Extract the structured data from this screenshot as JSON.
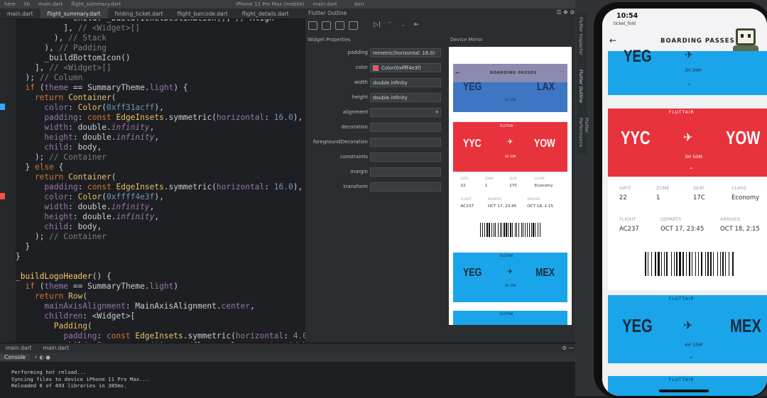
{
  "topbar": {
    "items": [
      "here",
      "lib",
      "main.dart",
      "flight_summary.dart",
      "iPhone 11 Pro Max (mobile)",
      "main.dart",
      "",
      "dart"
    ]
  },
  "tabs": [
    "main.dart",
    "flight_summary.dart",
    "folding_ticket.dart",
    "flight_barcode.dart",
    "flight_details.dart"
  ],
  "code_lines": [
    [
      [
        "pl",
        "            child: _buildTicketDestination(), // Align"
      ]
    ],
    [
      [
        "pl",
        "          ], "
      ],
      [
        "cm",
        "// <Widget>[]"
      ]
    ],
    [
      [
        "pl",
        "        ), "
      ],
      [
        "cm",
        "// Stack"
      ]
    ],
    [
      [
        "pl",
        "      ), "
      ],
      [
        "cm",
        "// Padding"
      ]
    ],
    [
      [
        "pl",
        "      _buildBottomIcon()"
      ]
    ],
    [
      [
        "pl",
        "    ], "
      ],
      [
        "cm",
        "// <Widget>[]"
      ]
    ],
    [
      [
        "pl",
        "  ); "
      ],
      [
        "cm",
        "// Column"
      ]
    ],
    [
      [
        "kw",
        "  if "
      ],
      [
        "pl",
        "("
      ],
      [
        "en",
        "theme"
      ],
      [
        "pl",
        " == SummaryTheme."
      ],
      [
        "en",
        "light"
      ],
      [
        "pl",
        ") {"
      ]
    ],
    [
      [
        "kw",
        "    return "
      ],
      [
        "cls",
        "Container"
      ],
      [
        "pl",
        "("
      ]
    ],
    [
      [
        "en",
        "      color"
      ],
      [
        "pl",
        ": "
      ],
      [
        "cls",
        "Color"
      ],
      [
        "pl",
        "("
      ],
      [
        "num",
        "0xff31acff"
      ],
      [
        "pl",
        "),"
      ]
    ],
    [
      [
        "en",
        "      padding"
      ],
      [
        "pl",
        ": "
      ],
      [
        "kw",
        "const "
      ],
      [
        "cls",
        "EdgeInsets"
      ],
      [
        "pl",
        ".symmetric("
      ],
      [
        "en",
        "horizontal"
      ],
      [
        "pl",
        ": "
      ],
      [
        "num",
        "16.0"
      ],
      [
        "pl",
        "),"
      ]
    ],
    [
      [
        "en",
        "      width"
      ],
      [
        "pl",
        ": double."
      ],
      [
        "it",
        "infinity"
      ],
      [
        "pl",
        ","
      ]
    ],
    [
      [
        "en",
        "      height"
      ],
      [
        "pl",
        ": double."
      ],
      [
        "it",
        "infinity"
      ],
      [
        "pl",
        ","
      ]
    ],
    [
      [
        "en",
        "      child"
      ],
      [
        "pl",
        ": body,"
      ]
    ],
    [
      [
        "pl",
        "    ); "
      ],
      [
        "cm",
        "// Container"
      ]
    ],
    [
      [
        "pl",
        "  } "
      ],
      [
        "kw",
        "else "
      ],
      [
        "pl",
        "{"
      ]
    ],
    [
      [
        "kw",
        "    return "
      ],
      [
        "cls",
        "Container"
      ],
      [
        "pl",
        "("
      ]
    ],
    [
      [
        "en",
        "      padding"
      ],
      [
        "pl",
        ": "
      ],
      [
        "kw",
        "const "
      ],
      [
        "cls",
        "EdgeInsets"
      ],
      [
        "pl",
        ".symmetric("
      ],
      [
        "en",
        "horizontal"
      ],
      [
        "pl",
        ": "
      ],
      [
        "num",
        "16.0"
      ],
      [
        "pl",
        "),"
      ]
    ],
    [
      [
        "en",
        "      color"
      ],
      [
        "pl",
        ": "
      ],
      [
        "cls",
        "Color"
      ],
      [
        "pl",
        "("
      ],
      [
        "num",
        "0xffff4e3f"
      ],
      [
        "pl",
        "),"
      ]
    ],
    [
      [
        "en",
        "      width"
      ],
      [
        "pl",
        ": double."
      ],
      [
        "it",
        "infinity"
      ],
      [
        "pl",
        ","
      ]
    ],
    [
      [
        "en",
        "      height"
      ],
      [
        "pl",
        ": double."
      ],
      [
        "it",
        "infinity"
      ],
      [
        "pl",
        ","
      ]
    ],
    [
      [
        "en",
        "      child"
      ],
      [
        "pl",
        ": body,"
      ]
    ],
    [
      [
        "pl",
        "    ); "
      ],
      [
        "cm",
        "// Container"
      ]
    ],
    [
      [
        "pl",
        "  }"
      ]
    ],
    [
      [
        "pl",
        "}"
      ]
    ],
    [
      [
        "pl",
        ""
      ]
    ],
    [
      [
        "fn",
        "_buildLogoHeader"
      ],
      [
        "pl",
        "() {"
      ]
    ],
    [
      [
        "kw",
        "  if "
      ],
      [
        "pl",
        "("
      ],
      [
        "en",
        "theme"
      ],
      [
        "pl",
        " == SummaryTheme."
      ],
      [
        "en",
        "light"
      ],
      [
        "pl",
        ")"
      ]
    ],
    [
      [
        "kw",
        "    return "
      ],
      [
        "cls",
        "Row"
      ],
      [
        "pl",
        "("
      ]
    ],
    [
      [
        "en",
        "      mainAxisAlignment"
      ],
      [
        "pl",
        ": MainAxisAlignment."
      ],
      [
        "en",
        "center"
      ],
      [
        "pl",
        ","
      ]
    ],
    [
      [
        "en",
        "      children"
      ],
      [
        "pl",
        ": <Widget>["
      ]
    ],
    [
      [
        "cls",
        "        Padding"
      ],
      [
        "pl",
        "("
      ]
    ],
    [
      [
        "en",
        "          padding"
      ],
      [
        "pl",
        ": "
      ],
      [
        "kw",
        "const "
      ],
      [
        "cls",
        "EdgeInsets"
      ],
      [
        "pl",
        ".symmetric("
      ],
      [
        "en",
        "horizontal"
      ],
      [
        "pl",
        ": "
      ],
      [
        "num",
        "4.0"
      ]
    ],
    [
      [
        "pl",
        "          child: Image.asset('images/flutter-logo.png', width"
      ]
    ]
  ],
  "bottom_tabs": [
    "main.dart",
    "main.dart"
  ],
  "console_tabs": [
    "Console"
  ],
  "console_lines": [
    "Performing hot reload...",
    "Syncing files to device iPhone 11 Pro Max...",
    "Reloaded 6 of 493 libraries in 385ms."
  ],
  "outline": {
    "title": "Flutter Outline",
    "widget_properties_title": "Widget Properties",
    "device_mirror_title": "Device Mirror",
    "properties": [
      {
        "label": "padding",
        "value": "mmetric(horizontal: 16.0)"
      },
      {
        "label": "color",
        "value": "Color(0xffff4e3f)",
        "swatch": "#ff4e3f"
      },
      {
        "label": "width",
        "value": "double.infinity"
      },
      {
        "label": "height",
        "value": "double.infinity"
      },
      {
        "label": "alignment",
        "value": ""
      },
      {
        "label": "decoration",
        "value": ""
      },
      {
        "label": "foregroundDecoration",
        "value": ""
      },
      {
        "label": "constraints",
        "value": ""
      },
      {
        "label": "margin",
        "value": ""
      },
      {
        "label": "transform",
        "value": ""
      }
    ]
  },
  "side_tabs": [
    "Flutter Inspector",
    "Flutter Outline",
    "Flutter Performance"
  ],
  "phone": {
    "time": "10:54",
    "app_label": "ticket_fold",
    "title": "BOARDING PASSES",
    "top_card": {
      "from": "YEG",
      "duration": "3H 30M"
    },
    "main_card": {
      "brand": "FLUTTAIR",
      "from": "YYC",
      "to": "YOW",
      "duration": "3H 50M"
    },
    "details": [
      {
        "label": "GATE",
        "value": "22"
      },
      {
        "label": "ZONE",
        "value": "1"
      },
      {
        "label": "SEAT",
        "value": "17C"
      },
      {
        "label": "CLASS",
        "value": "Economy"
      },
      {
        "label": "FLIGHT",
        "value": "AC237"
      },
      {
        "label": "DEPARTS",
        "value": "OCT 17, 23:45"
      },
      {
        "label": "ARRIVES",
        "value": "OCT 18, 2:15"
      }
    ],
    "third_card": {
      "brand": "FLUTTAIR",
      "from": "YEG",
      "to": "MEX",
      "duration": "4H 15M"
    },
    "fourth_card": {
      "brand": "FLUTTAIR"
    }
  },
  "mirror": {
    "title": "BOARDING PASSES",
    "card1": {
      "from": "YEG",
      "to": "LAX",
      "duration": "3H 30M"
    },
    "card2": {
      "brand": "FLUTTAIR",
      "from": "YYC",
      "to": "YOW",
      "duration": "3H 50M"
    },
    "details": [
      {
        "label": "GATE",
        "value": "22"
      },
      {
        "label": "ZONE",
        "value": "1"
      },
      {
        "label": "SEAT",
        "value": "17C"
      },
      {
        "label": "CLASS",
        "value": "Economy"
      },
      {
        "label": "FLIGHT",
        "value": "AC237"
      },
      {
        "label": "DEPARTS",
        "value": "OCT 17, 23:45"
      },
      {
        "label": "ARRIVES",
        "value": "OCT 18, 2:15"
      }
    ],
    "card3": {
      "brand": "FLUTTAIR",
      "from": "YEG",
      "to": "MEX",
      "duration": "4H 15M"
    },
    "card4": {
      "brand": "FLUTTAIR"
    }
  },
  "colors": {
    "blue": "#1aa5ea",
    "red": "#e8323c",
    "lavender": "#8d8ab0"
  }
}
